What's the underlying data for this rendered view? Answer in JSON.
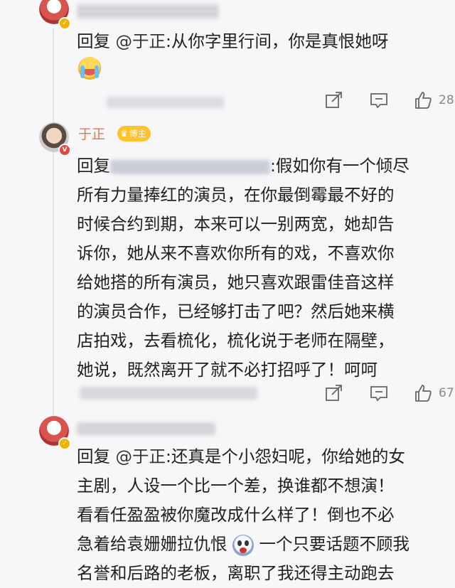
{
  "comments": [
    {
      "reply_prefix": "回复",
      "mention": "@于正",
      "text": ":从你字里行间，你是真恨她呀",
      "emoji": "crying-emoji",
      "like_count": "28"
    },
    {
      "author": "于正",
      "badge": "博主",
      "reply_prefix": "回复",
      "lines": [
        ":假如你有一个倾尽",
        "所有力量捧红的演员，在你最倒霉最不好的",
        "时候合约到期，本来可以一别两宽，她却告",
        "诉你，她从来不喜欢你所有的戏，不喜欢你",
        "给她搭的所有演员，她只喜欢跟雷佳音这样",
        "的演员合作，已经够打击了吧？然后她来横",
        "店拍戏，去看梳化，梳化说于老师在隔壁，",
        "她说，既然离开了就不必打招呼了！呵呵"
      ],
      "like_count": "67"
    },
    {
      "reply_prefix": "回复",
      "mention": "@于正",
      "lines": [
        ":还真是个小怨妇呢，你给她的女",
        "主剧，人设一个比一个差，换谁都不想演！",
        "看看任盈盈被你魔改成什么样了！倒也不必",
        "急着给袁姗姗拉仇恨",
        "一个只要话题不顾我",
        "名誉和后路的老板，离职了我还得主动跑去"
      ],
      "emoji": "fearful-emoji"
    }
  ],
  "colors": {
    "author": "#eb7340",
    "badge": "#ffc228",
    "icon": "#666666"
  }
}
